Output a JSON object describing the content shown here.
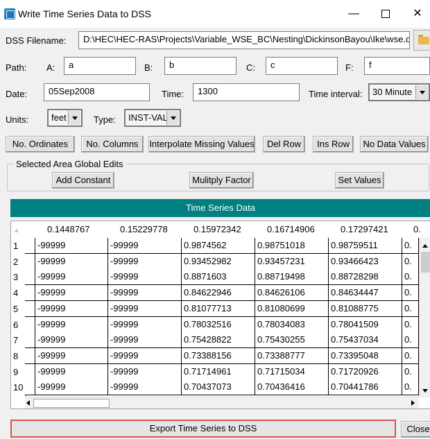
{
  "window": {
    "title": "Write Time Series Data to DSS",
    "controls": {
      "minimize": "—",
      "close": "✕"
    }
  },
  "filename": {
    "label": "DSS Filename:",
    "value": "D:\\HEC\\HEC-RAS\\Projects\\Variable_WSE_BC\\Nesting\\DickinsonBayou\\Ike\\wse.dss"
  },
  "path": {
    "label": "Path:",
    "parts": [
      {
        "label": "A:",
        "value": "a"
      },
      {
        "label": "B:",
        "value": "b"
      },
      {
        "label": "C:",
        "value": "c"
      },
      {
        "label": "F:",
        "value": "f"
      }
    ]
  },
  "date": {
    "label": "Date:",
    "value": "05Sep2008"
  },
  "time": {
    "label": "Time:",
    "value": "1300"
  },
  "interval": {
    "label": "Time interval:",
    "value": "30 Minute"
  },
  "units": {
    "label": "Units:",
    "value": "feet"
  },
  "type": {
    "label": "Type:",
    "value": "INST-VAL"
  },
  "buttons": {
    "no_ordinates": "No. Ordinates",
    "no_columns": "No. Columns",
    "interpolate": "Interpolate Missing Values",
    "del_row": "Del Row",
    "ins_row": "Ins Row",
    "no_data": "No Data Values"
  },
  "global_edits": {
    "title": "Selected Area Global Edits",
    "add_constant": "Add Constant",
    "multiply_factor": "Mulitply Factor",
    "set_values": "Set Values"
  },
  "table": {
    "title": "Time Series Data",
    "headers": [
      "0.1448767",
      "0.15229778",
      "0.15972342",
      "0.16714906",
      "0.17297421",
      "0."
    ],
    "rows": [
      [
        "1",
        "-99999",
        "-99999",
        "0.9874562",
        "0.98751018",
        "0.98759511",
        "0."
      ],
      [
        "2",
        "-99999",
        "-99999",
        "0.93452982",
        "0.93457231",
        "0.93466423",
        "0."
      ],
      [
        "3",
        "-99999",
        "-99999",
        "0.8871603",
        "0.88719498",
        "0.88728298",
        "0."
      ],
      [
        "4",
        "-99999",
        "-99999",
        "0.84622946",
        "0.84626106",
        "0.84634447",
        "0."
      ],
      [
        "5",
        "-99999",
        "-99999",
        "0.81077713",
        "0.81080699",
        "0.81088775",
        "0."
      ],
      [
        "6",
        "-99999",
        "-99999",
        "0.78032516",
        "0.78034083",
        "0.78041509",
        "0."
      ],
      [
        "7",
        "-99999",
        "-99999",
        "0.75428822",
        "0.75430255",
        "0.75437034",
        "0."
      ],
      [
        "8",
        "-99999",
        "-99999",
        "0.73388156",
        "0.73388777",
        "0.73395048",
        "0."
      ],
      [
        "9",
        "-99999",
        "-99999",
        "0.71714961",
        "0.71715034",
        "0.71720926",
        "0."
      ],
      [
        "10",
        "-99999",
        "-99999",
        "0.70437073",
        "0.70436416",
        "0.70441786",
        "0."
      ]
    ]
  },
  "export_label": "Export Time Series to DSS",
  "close_label": "Close"
}
